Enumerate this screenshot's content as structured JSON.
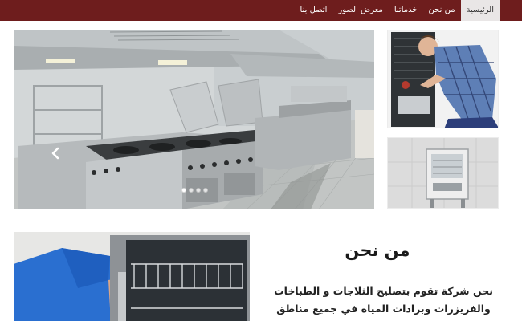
{
  "nav": {
    "items": [
      {
        "label": "الرئيسية",
        "active": true
      },
      {
        "label": "من نحن",
        "active": false
      },
      {
        "label": "خدماتنا",
        "active": false
      },
      {
        "label": "معرض الصور",
        "active": false
      },
      {
        "label": "اتصل بنا",
        "active": false
      }
    ]
  },
  "slider": {
    "image": "commercial-kitchen-photo",
    "prev_icon": "chevron-left-icon",
    "slide_count": 4,
    "active_slide": 1
  },
  "side_images": [
    {
      "image": "technician-repairing-fridge-photo"
    },
    {
      "image": "water-cooler-photo"
    }
  ],
  "about": {
    "image": "dishwasher-repair-photo",
    "title": "من نحن",
    "line1": "نحن شركة تقوم بتصليح الثلاجات و الطباخات",
    "line2": "والفريزرات وبرادات المياه في جميع مناطق الكويت حيث"
  },
  "colors": {
    "nav_bg": "#6e1d1d",
    "nav_active_bg": "#e9e6e6"
  }
}
